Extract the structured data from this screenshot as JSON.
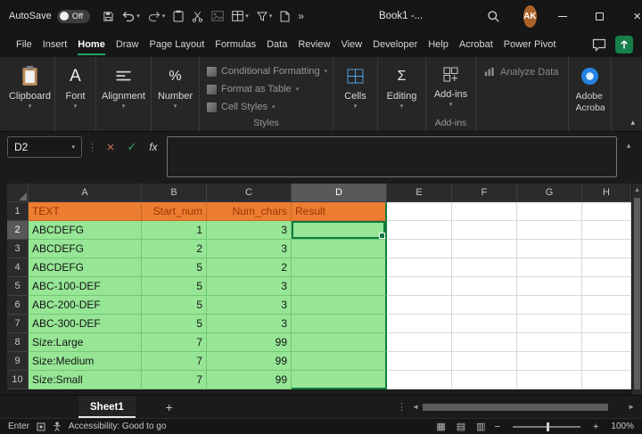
{
  "title_bar": {
    "autosave_label": "AutoSave",
    "autosave_state": "Off",
    "document_title": "Book1  -...",
    "overflow_glyph": "»",
    "avatar_initials": "AK"
  },
  "menu": {
    "tabs": [
      "File",
      "Insert",
      "Home",
      "Draw",
      "Page Layout",
      "Formulas",
      "Data",
      "Review",
      "View",
      "Developer",
      "Help",
      "Acrobat",
      "Power Pivot"
    ],
    "active_tab": "Home"
  },
  "ribbon": {
    "collapsed_groups": [
      {
        "label": "Clipboard"
      },
      {
        "label": "Font"
      },
      {
        "label": "Alignment"
      },
      {
        "label": "Number"
      }
    ],
    "styles_group": {
      "label": "Styles",
      "items": [
        "Conditional Formatting",
        "Format as Table",
        "Cell Styles"
      ]
    },
    "cells_group": {
      "label": "Cells"
    },
    "editing_group": {
      "label": "Editing"
    },
    "addins_group": {
      "button_label": "Add-ins",
      "group_label": "Add-ins"
    },
    "analyze_button": "Analyze Data",
    "acrobat_button": "Adobe Acrobat"
  },
  "formula_bar": {
    "name_box": "D2",
    "fx_label": "fx",
    "formula_value": ""
  },
  "grid": {
    "column_headers": [
      "A",
      "B",
      "C",
      "D",
      "E",
      "F",
      "G",
      "H"
    ],
    "selected_cell": "D2",
    "selected_column": "D",
    "selected_row": 2,
    "header_row": {
      "row": 1,
      "cells": [
        "TEXT",
        "Start_num",
        "Num_chars",
        "Result"
      ]
    },
    "data_rows": [
      {
        "row": 2,
        "cells": [
          "ABCDEFG",
          "1",
          "3",
          ""
        ]
      },
      {
        "row": 3,
        "cells": [
          "ABCDEFG",
          "2",
          "3",
          ""
        ]
      },
      {
        "row": 4,
        "cells": [
          "ABCDEFG",
          "5",
          "2",
          ""
        ]
      },
      {
        "row": 5,
        "cells": [
          "ABC-100-DEF",
          "5",
          "3",
          ""
        ]
      },
      {
        "row": 6,
        "cells": [
          "ABC-200-DEF",
          "5",
          "3",
          ""
        ]
      },
      {
        "row": 7,
        "cells": [
          "ABC-300-DEF",
          "5",
          "3",
          ""
        ]
      },
      {
        "row": 8,
        "cells": [
          "Size:Large",
          "7",
          "99",
          ""
        ]
      },
      {
        "row": 9,
        "cells": [
          "Size:Medium",
          "7",
          "99",
          ""
        ]
      },
      {
        "row": 10,
        "cells": [
          "Size:Small",
          "7",
          "99",
          ""
        ]
      }
    ],
    "colors": {
      "header_fill": "#ED7D31",
      "header_text": "#9C3400",
      "data_fill": "#96E696",
      "selection_border": "#0F7B3F"
    }
  },
  "sheet_bar": {
    "tabs": [
      "Sheet1"
    ],
    "active_tab": "Sheet1",
    "add_button": "+"
  },
  "status_bar": {
    "mode": "Enter",
    "accessibility_text": "Accessibility: Good to go",
    "zoom_level": "100%"
  }
}
